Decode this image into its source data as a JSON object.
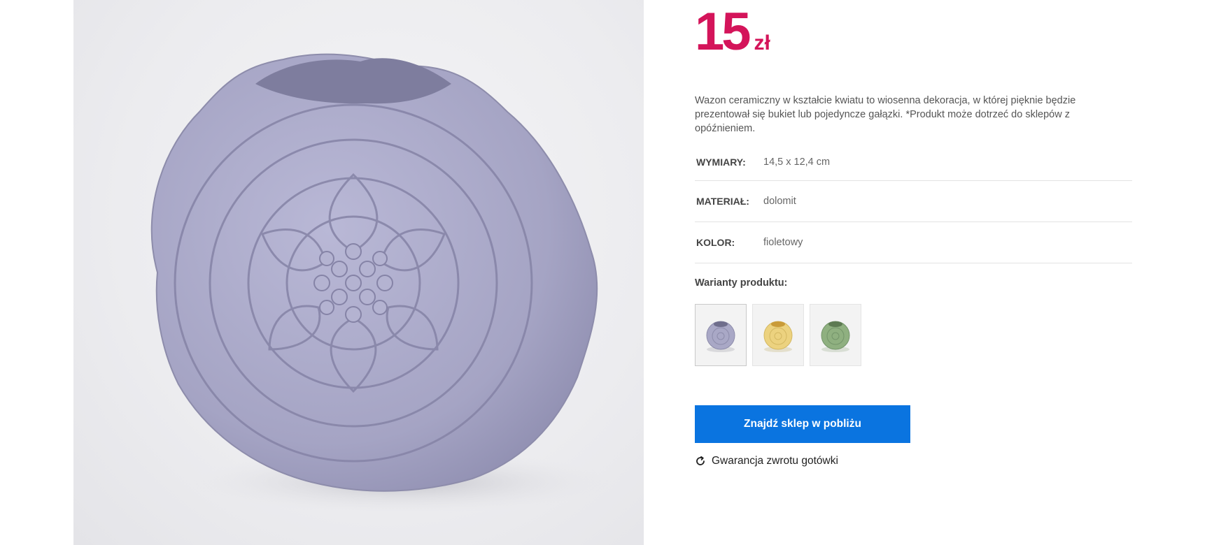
{
  "product": {
    "image_alt": "fioletowy wazon ceramiczny w kształcie kwiatu",
    "price": {
      "value": "15",
      "currency": "zł",
      "color": "#d4145a"
    },
    "description": "Wazon ceramiczny w kształcie kwiatu to wiosenna dekoracja, w której pięknie będzie prezentował się bukiet lub pojedyncze gałązki. *Produkt może dotrzeć do sklepów z opóźnieniem.",
    "specs": [
      {
        "label": "WYMIARY:",
        "value": "14,5 x 12,4 cm"
      },
      {
        "label": "MATERIAŁ:",
        "value": "dolomit"
      },
      {
        "label": "KOLOR:",
        "value": "fioletowy"
      }
    ],
    "variants_title": "Warianty produktu:",
    "variants": [
      {
        "color": "#a9a8c6",
        "selected": true
      },
      {
        "color": "#ecd27f",
        "selected": false
      },
      {
        "color": "#8fb080",
        "selected": false
      }
    ],
    "store_button_label": "Znajdź sklep w pobliżu",
    "store_button_color": "#0a74e0",
    "guarantee_label": "Gwarancja zwrotu gotówki",
    "guarantee_icon": "refresh-icon"
  }
}
